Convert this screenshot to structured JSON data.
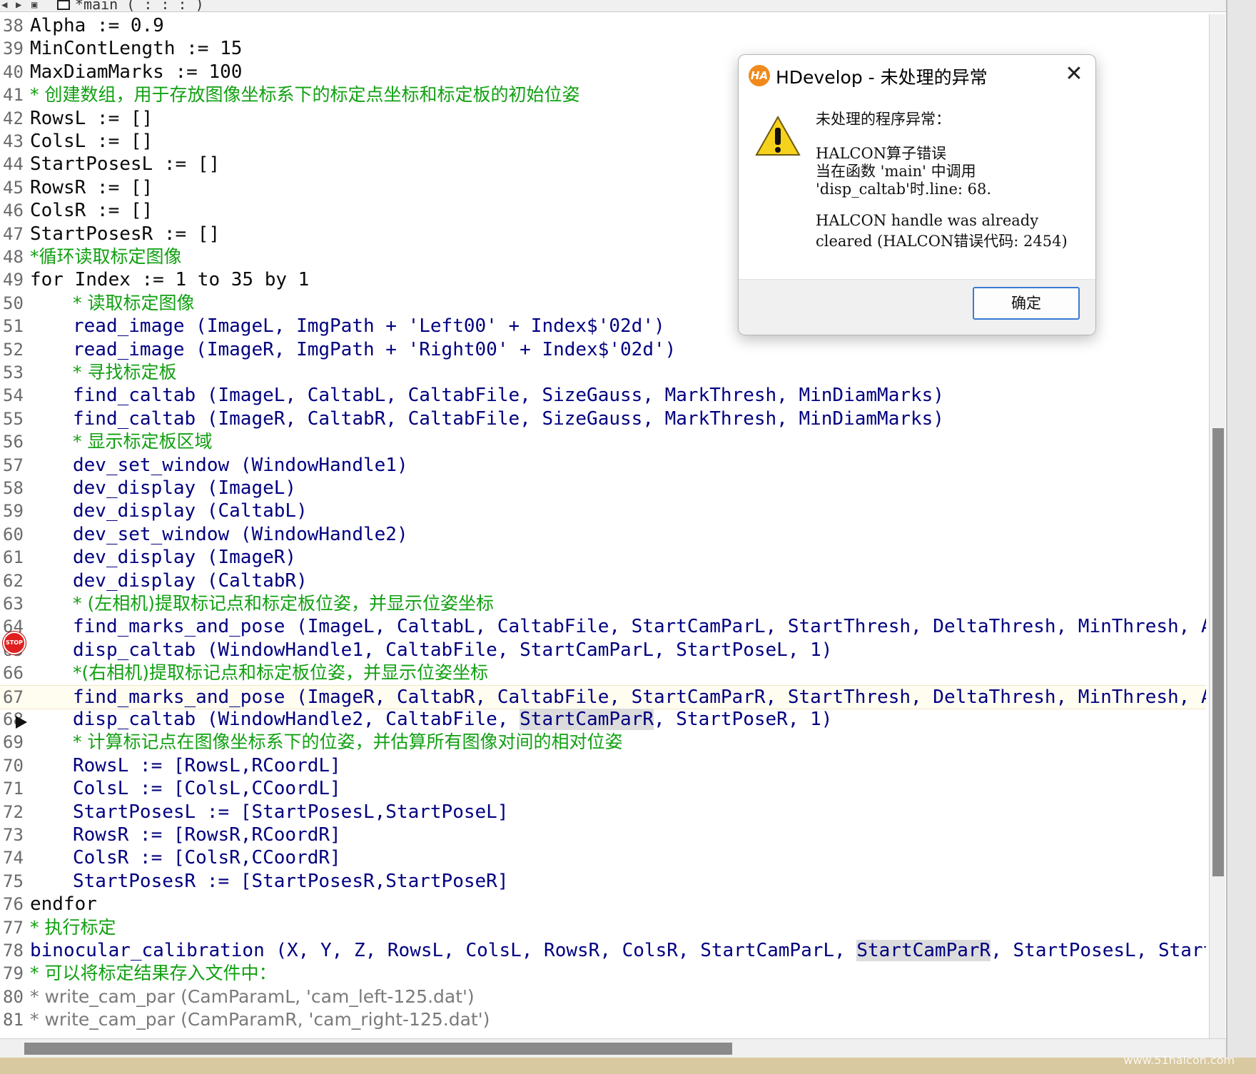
{
  "window": {
    "tab_title": "*main ( : : : )"
  },
  "editor": {
    "lines": [
      {
        "n": "38",
        "text": "Alpha := 0.9",
        "kind": "top"
      },
      {
        "n": "39",
        "text": "MinContLength := 15",
        "kind": "top"
      },
      {
        "n": "40",
        "text": "MaxDiamMarks := 100",
        "kind": "top"
      },
      {
        "n": "41",
        "text": "* 创建数组，用于存放图像坐标系下的标定点坐标和标定板的初始位姿",
        "kind": "cmt"
      },
      {
        "n": "42",
        "text": "RowsL := []",
        "kind": "top"
      },
      {
        "n": "43",
        "text": "ColsL := []",
        "kind": "top"
      },
      {
        "n": "44",
        "text": "StartPosesL := []",
        "kind": "top"
      },
      {
        "n": "45",
        "text": "RowsR := []",
        "kind": "top"
      },
      {
        "n": "46",
        "text": "ColsR := []",
        "kind": "top"
      },
      {
        "n": "47",
        "text": "StartPosesR := []",
        "kind": "top"
      },
      {
        "n": "48",
        "text": "*循环读取标定图像",
        "kind": "cmt"
      },
      {
        "n": "49",
        "text": "for Index := 1 to 35 by 1",
        "kind": "top"
      },
      {
        "n": "50",
        "text": "* 读取标定图像",
        "kind": "cmt-ind"
      },
      {
        "n": "51",
        "text": "read_image (ImageL, ImgPath + 'Left00' + Index$'02d')",
        "kind": "ind"
      },
      {
        "n": "52",
        "text": "read_image (ImageR, ImgPath + 'Right00' + Index$'02d')",
        "kind": "ind"
      },
      {
        "n": "53",
        "text": "* 寻找标定板",
        "kind": "cmt-ind"
      },
      {
        "n": "54",
        "text": "find_caltab (ImageL, CaltabL, CaltabFile, SizeGauss, MarkThresh, MinDiamMarks)",
        "kind": "ind"
      },
      {
        "n": "55",
        "text": "find_caltab (ImageR, CaltabR, CaltabFile, SizeGauss, MarkThresh, MinDiamMarks)",
        "kind": "ind"
      },
      {
        "n": "56",
        "text": "* 显示标定板区域",
        "kind": "cmt-ind"
      },
      {
        "n": "57",
        "text": "dev_set_window (WindowHandle1)",
        "kind": "ind"
      },
      {
        "n": "58",
        "text": "dev_display (ImageL)",
        "kind": "ind"
      },
      {
        "n": "59",
        "text": "dev_display (CaltabL)",
        "kind": "ind"
      },
      {
        "n": "60",
        "text": "dev_set_window (WindowHandle2)",
        "kind": "ind"
      },
      {
        "n": "61",
        "text": "dev_display (ImageR)",
        "kind": "ind"
      },
      {
        "n": "62",
        "text": "dev_display (CaltabR)",
        "kind": "ind"
      },
      {
        "n": "63",
        "text": "* (左相机)提取标记点和标定板位姿，并显示位姿坐标",
        "kind": "cmt-ind"
      },
      {
        "n": "64",
        "text": "find_marks_and_pose (ImageL, CaltabL, CaltabFile, StartCamParL, StartThresh, DeltaThresh, MinThresh, Alpha",
        "kind": "ind"
      },
      {
        "n": "65",
        "text": "disp_caltab (WindowHandle1, CaltabFile, StartCamParL, StartPoseL, 1)",
        "kind": "ind"
      },
      {
        "n": "66",
        "text": "*(右相机)提取标记点和标定板位姿，并显示位姿坐标",
        "kind": "cmt-ind"
      },
      {
        "n": "67",
        "text": "find_marks_and_pose (ImageR, CaltabR, CaltabFile, StartCamParR, StartThresh, DeltaThresh, MinThresh, Alpha",
        "kind": "ind"
      },
      {
        "n": "68",
        "text_pre": "disp_caltab (WindowHandle2, CaltabFile, ",
        "text_hl": "StartCamParR",
        "text_post": ", StartPoseR, 1)",
        "kind": "ind-hl"
      },
      {
        "n": "69",
        "text": "* 计算标记点在图像坐标系下的位姿，并估算所有图像对间的相对位姿",
        "kind": "cmt-ind"
      },
      {
        "n": "70",
        "text": "RowsL := [RowsL,RCoordL]",
        "kind": "ind"
      },
      {
        "n": "71",
        "text": "ColsL := [ColsL,CCoordL]",
        "kind": "ind"
      },
      {
        "n": "72",
        "text": "StartPosesL := [StartPosesL,StartPoseL]",
        "kind": "ind"
      },
      {
        "n": "73",
        "text": "RowsR := [RowsR,RCoordR]",
        "kind": "ind"
      },
      {
        "n": "74",
        "text": "ColsR := [ColsR,CCoordR]",
        "kind": "ind"
      },
      {
        "n": "75",
        "text": "StartPosesR := [StartPosesR,StartPoseR]",
        "kind": "ind"
      },
      {
        "n": "76",
        "text": "endfor",
        "kind": "top"
      },
      {
        "n": "77",
        "text": "* 执行标定",
        "kind": "cmt"
      },
      {
        "n": "78",
        "text_pre": "binocular_calibration (X, Y, Z, RowsL, ColsL, RowsR, ColsR, StartCamParL, ",
        "text_hl": "StartCamParR",
        "text_post": ", StartPosesL, StartPose",
        "kind": "top-hl"
      },
      {
        "n": "79",
        "text": "* 可以将标定结果存入文件中：",
        "kind": "cmt"
      },
      {
        "n": "80",
        "text": "* write_cam_par (CamParamL, 'cam_left-125.dat')",
        "kind": "cmt-gray"
      },
      {
        "n": "81",
        "text": "* write_cam_par (CamParamR, 'cam_right-125.dat')",
        "kind": "cmt-gray"
      }
    ]
  },
  "dialog": {
    "title": "HDevelop - 未处理的异常",
    "app_icon_text": "HA",
    "heading": "未处理的程序异常：",
    "msg1": "HALCON算子错误",
    "msg2": "当在函数 'main' 中调用",
    "msg3": "'disp_caltab'时.line: 68.",
    "msg4": "HALCON handle was already",
    "msg5": "cleared (HALCON错误代码: 2454)",
    "ok_label": "确定",
    "close_icon": "close-icon",
    "warning_icon": "warning-icon"
  },
  "markers": {
    "breakpoint_text": "STOP"
  },
  "watermark": "www.51halcon.com",
  "colors": {
    "code": "#000080",
    "comment": "#11a011",
    "keyword": "#0a0a0a",
    "line_number": "#6b6b6b",
    "ok_border": "#3a7bd5"
  }
}
